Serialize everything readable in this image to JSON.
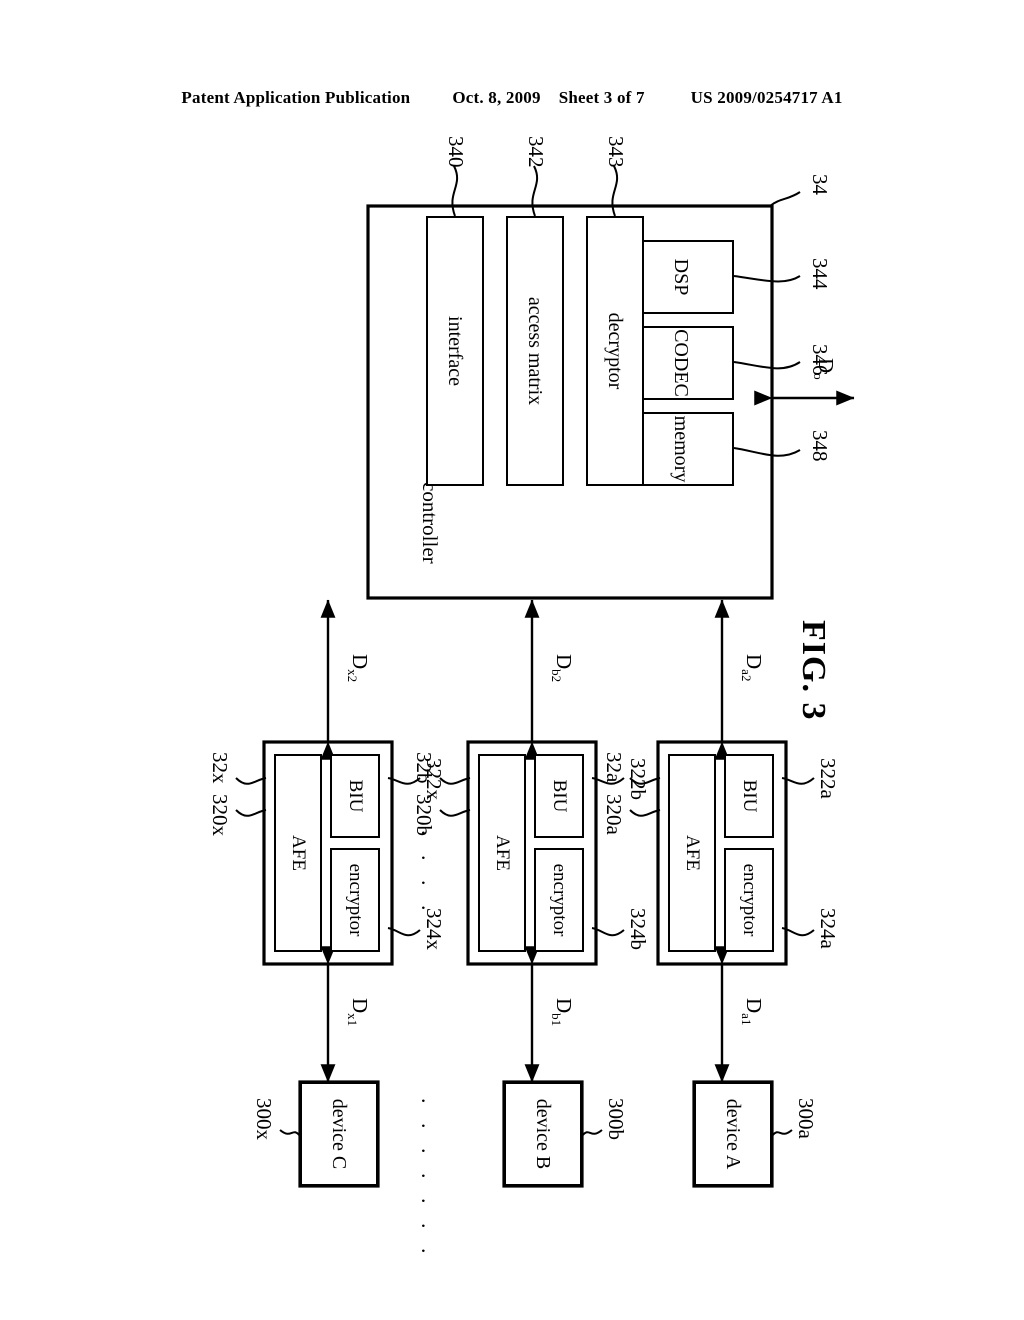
{
  "header": {
    "publication": "Patent Application Publication",
    "date": "Oct. 8, 2009",
    "sheet": "Sheet 3 of 7",
    "docnum": "US 2009/0254717 A1"
  },
  "figure": {
    "caption": "FIG. 3",
    "ellipsis_devices": ". . . . . . .",
    "ellipsis_modules": ". . . ."
  },
  "controller": {
    "ref": "34",
    "label": "controller",
    "output_signal": "D",
    "output_signal_sub": "o",
    "blocks": [
      {
        "ref": "344",
        "label": "DSP"
      },
      {
        "ref": "346",
        "label": "CODEC"
      },
      {
        "ref": "348",
        "label": "memory"
      },
      {
        "ref": "343",
        "label": "decryptor"
      },
      {
        "ref": "342",
        "label": "access matrix"
      },
      {
        "ref": "340",
        "label": "interface"
      }
    ]
  },
  "modules": [
    {
      "ref": "32a",
      "afe_ref": "320a",
      "biu_ref": "322a",
      "enc_ref": "324a",
      "afe_label": "AFE",
      "biu_label": "BIU",
      "enc_label": "encryptor",
      "up_signal": "D",
      "up_sub": "a2",
      "down_signal": "D",
      "down_sub": "a1"
    },
    {
      "ref": "32b",
      "afe_ref": "320b",
      "biu_ref": "322b",
      "enc_ref": "324b",
      "afe_label": "AFE",
      "biu_label": "BIU",
      "enc_label": "encryptor",
      "up_signal": "D",
      "up_sub": "b2",
      "down_signal": "D",
      "down_sub": "b1"
    },
    {
      "ref": "32x",
      "afe_ref": "320x",
      "biu_ref": "322x",
      "enc_ref": "324x",
      "afe_label": "AFE",
      "biu_label": "BIU",
      "enc_label": "encryptor",
      "up_signal": "D",
      "up_sub": "x2",
      "down_signal": "D",
      "down_sub": "x1"
    }
  ],
  "devices": [
    {
      "ref": "300a",
      "label": "device A"
    },
    {
      "ref": "300b",
      "label": "device B"
    },
    {
      "ref": "300x",
      "label": "device C"
    }
  ]
}
